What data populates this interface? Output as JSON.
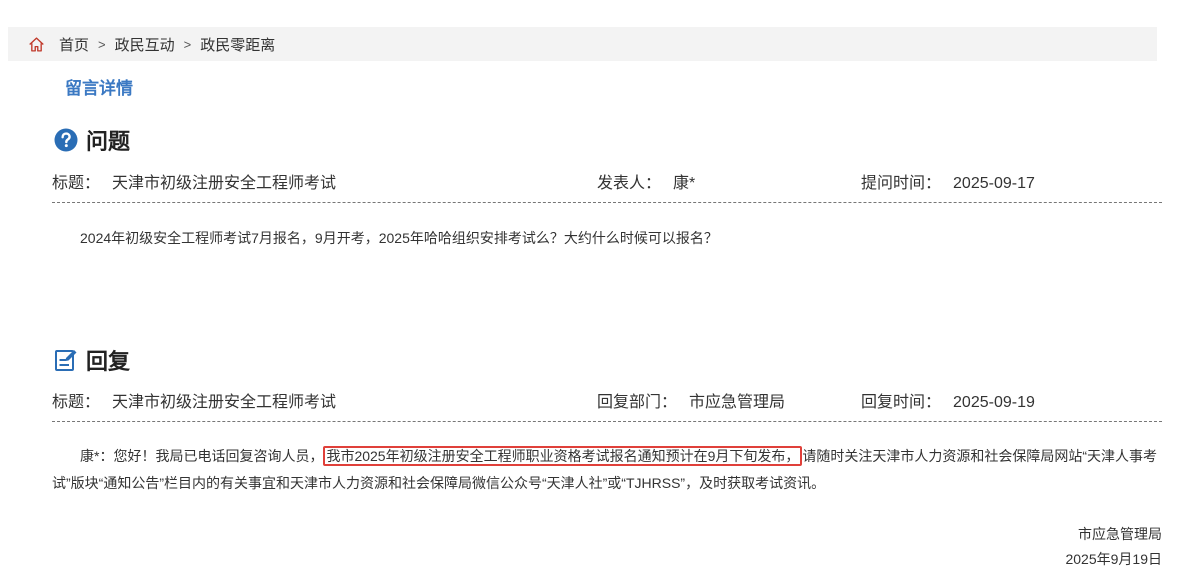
{
  "breadcrumb": {
    "home": "首页",
    "sep": ">",
    "level2": "政民互动",
    "level3": "政民零距离"
  },
  "subtitle": "留言详情",
  "question": {
    "heading": "问题",
    "title_label": "标题：",
    "title": "天津市初级注册安全工程师考试",
    "author_label": "发表人：",
    "author": "康*",
    "time_label": "提问时间：",
    "time": "2025-09-17",
    "body": "2024年初级安全工程师考试7月报名，9月开考，2025年哈哈组织安排考试么？大约什么时候可以报名？"
  },
  "reply": {
    "heading": "回复",
    "title_label": "标题：",
    "title": "天津市初级注册安全工程师考试",
    "dept_label": "回复部门：",
    "dept": "市应急管理局",
    "time_label": "回复时间：",
    "time": "2025-09-19",
    "body_pre": "康*：您好！我局已电话回复咨询人员，",
    "body_highlight": "我市2025年初级注册安全工程师职业资格考试报名通知预计在9月下旬发布，",
    "body_post": "请随时关注天津市人力资源和社会保障局网站“天津人事考试”版块“通知公告”栏目内的有关事宜和天津市人力资源和社会保障局微信公众号“天津人社”或“TJHRSS”，及时获取考试资讯。",
    "signature": "市应急管理局",
    "date": "2025年9月19日"
  },
  "colors": {
    "accent": "#3b79c3",
    "question_icon": "#2a6db5",
    "highlight_border": "#e0403a",
    "home_icon": "#c0392b"
  },
  "icons": {
    "home": "home-icon",
    "question": "question-circle-icon",
    "reply": "edit-note-icon"
  }
}
